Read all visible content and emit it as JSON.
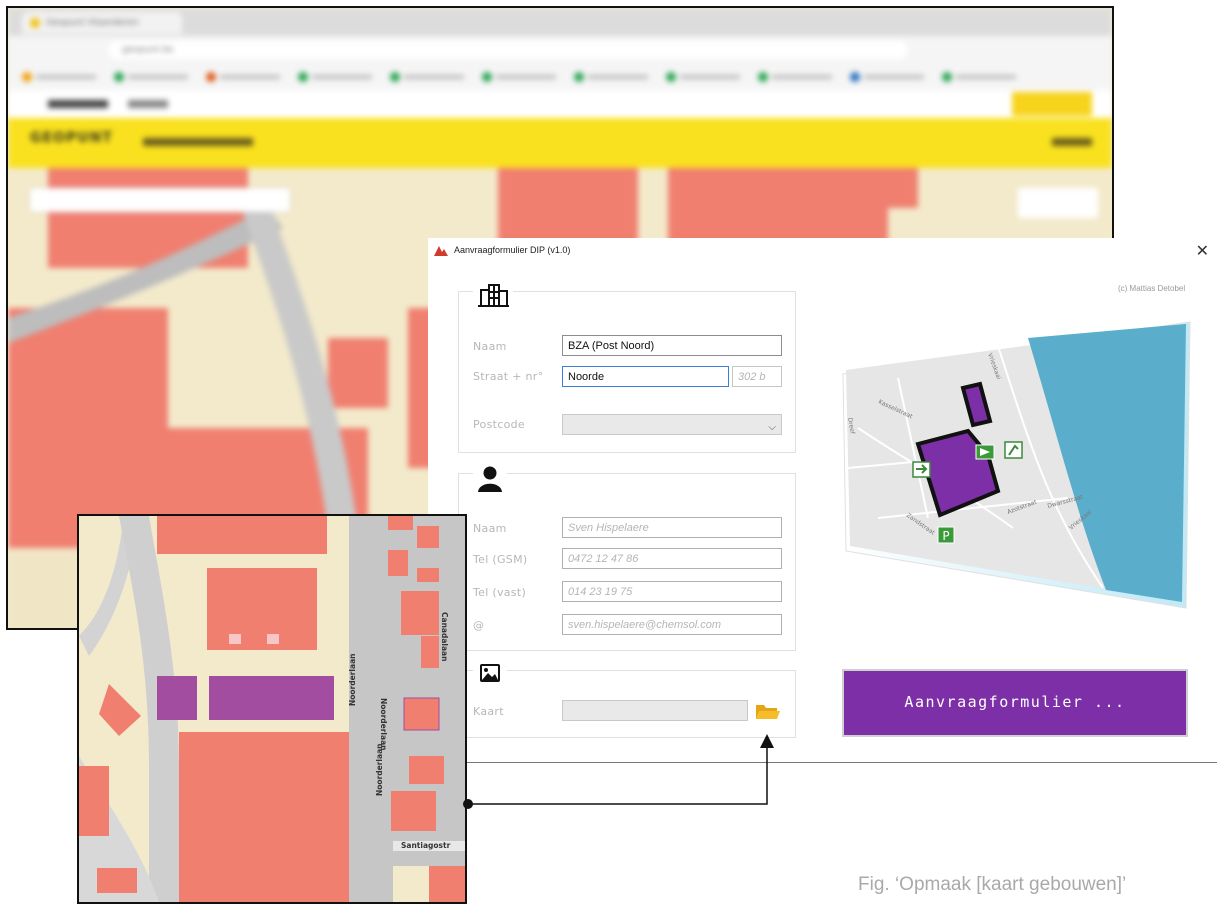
{
  "browser": {
    "tab_title": "Geopunt Vlaanderen",
    "url": "geopunt.be",
    "site_logo": "GEOPUNT",
    "bookmark_colors": [
      "#f1a20f",
      "#2aa552",
      "#e05a1a",
      "#2aa552",
      "#2aa552",
      "#2aa552",
      "#2aa552",
      "#2aa552",
      "#2aa552",
      "#2a70c0",
      "#2aa552"
    ]
  },
  "dialog": {
    "title": "Aanvraagformulier DIP (v1.0)",
    "close_glyph": "✕",
    "copyright": "(c) Mattias Detobel",
    "building": {
      "icon": "building-icon",
      "name_label": "Naam",
      "name_value": "BZA (Post Noord)",
      "street_label": "Straat + nr°",
      "street_value": "Noorde",
      "number_placeholder": "302 b",
      "postcode_label": "Postcode",
      "postcode_value": ""
    },
    "contact": {
      "icon": "person-icon",
      "name_label": "Naam",
      "name_placeholder": "Sven Hispelaere",
      "gsm_label": "Tel (GSM)",
      "gsm_placeholder": "0472 12 47 86",
      "fixed_label": "Tel (vast)",
      "fixed_placeholder": "014 23 19 75",
      "email_label": "@",
      "email_placeholder": "sven.hispelaere@chemsol.com"
    },
    "map": {
      "icon": "image-icon",
      "kaart_label": "Kaart",
      "kaart_value": "",
      "folder_icon": "folder-icon"
    },
    "preview": {
      "street_labels": [
        "Vrieskaai",
        "Kasselstraat",
        "Azotstraat",
        "Dwarsstraat",
        "Vrieskaai",
        "Dreef",
        "Zandstraat"
      ],
      "sign_labels": [
        "P"
      ]
    },
    "submit_label": "Aanvraagformulier ..."
  },
  "inset_map": {
    "street_labels": [
      "Noorderlaan",
      "Noorderlaan",
      "Noorderlaan",
      "Canadalaan",
      "Santiagostr"
    ]
  },
  "caption": "Fig. ‘Opmaak [kaart gebouwen]’",
  "colors": {
    "accent_purple": "#7c2fa6",
    "map_building": "#f07f70",
    "map_background": "#f3eacb",
    "site_yellow": "#f9e11f",
    "water": "#5aaecb"
  }
}
